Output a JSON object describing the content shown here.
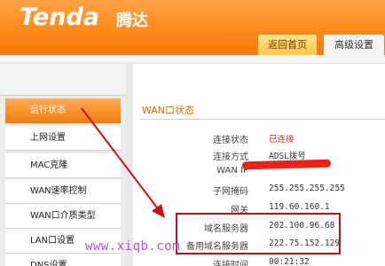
{
  "brand": {
    "logo": "Tenda",
    "logo_cn": "腾达"
  },
  "tabs": [
    {
      "label": "返回首页"
    },
    {
      "label": "高级设置"
    }
  ],
  "sidebar": {
    "items": [
      {
        "label": "运行状态",
        "active": true
      },
      {
        "label": "上网设置"
      },
      {
        "label": "MAC克隆"
      },
      {
        "label": "WAN速率控制"
      },
      {
        "label": "WAN口介质类型"
      },
      {
        "label": "LAN口设置"
      },
      {
        "label": "DNS设置"
      }
    ]
  },
  "wan_status": {
    "title": "WAN口状态",
    "rows": [
      {
        "label": "连接状态",
        "value": "已连接"
      },
      {
        "label": "连接方式",
        "value": "ADSL拨号"
      },
      {
        "label": "WAN IP",
        "value": ""
      },
      {
        "label": "子网掩码",
        "value": "255.255.255.255"
      },
      {
        "label": "网关",
        "value": "119.60.160.1"
      },
      {
        "label": "域名服务器",
        "value": "202.100.96.68"
      },
      {
        "label": "备用域名服务器",
        "value": "222.75.152.129"
      },
      {
        "label": "连接时间",
        "value": "00:21:32"
      }
    ]
  },
  "colors": {
    "header_orange": "#ff8a1c",
    "status_red": "#e0271b",
    "highlight_box": "#b4121a",
    "arrow": "#c8121a",
    "watermark": "#b14cf0"
  },
  "watermark": "www.xiqb.com"
}
